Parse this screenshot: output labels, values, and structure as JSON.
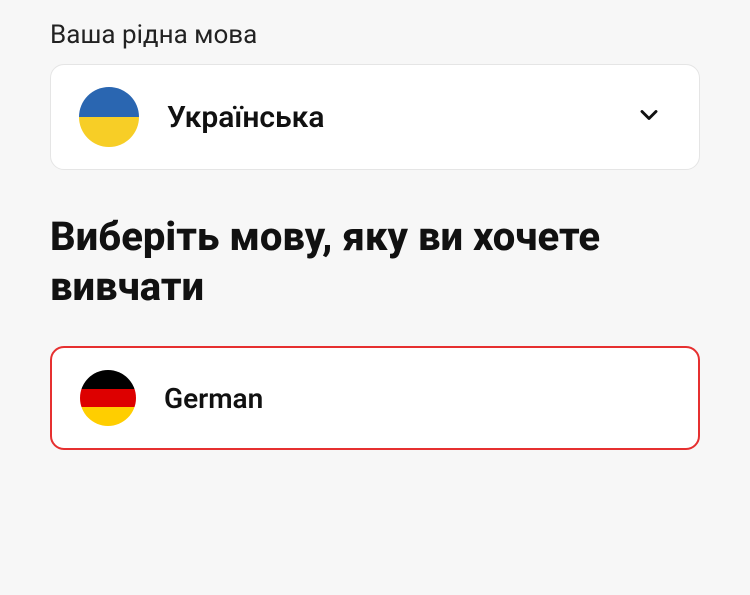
{
  "native_language_label": "Ваша рідна мова",
  "native_language": {
    "name": "Українська",
    "flag": "ukraine"
  },
  "heading": "Виберіть мову, яку ви хочете вивчати",
  "target_language": {
    "name": "German",
    "flag": "germany",
    "highlighted": true
  }
}
